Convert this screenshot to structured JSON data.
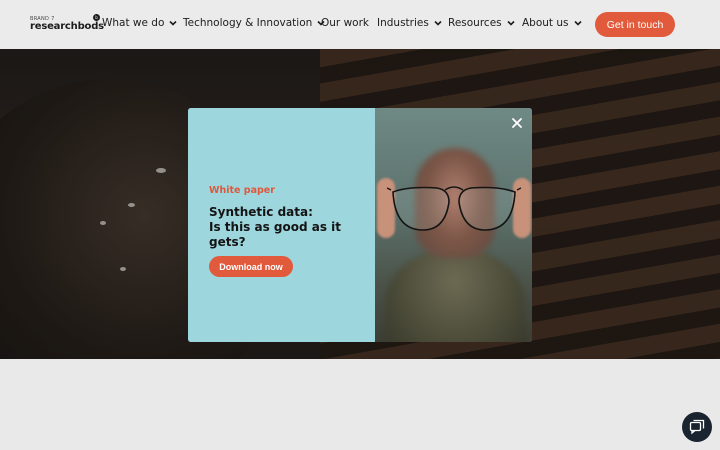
{
  "header": {
    "logo_small": "BRAND 7",
    "logo_main": "researchbods",
    "logo_badge": "b",
    "nav": [
      {
        "label": "What we do",
        "dropdown": true
      },
      {
        "label": "Technology & Innovation",
        "dropdown": true
      },
      {
        "label": "Our work",
        "dropdown": false
      },
      {
        "label": "Industries",
        "dropdown": true
      },
      {
        "label": "Resources",
        "dropdown": true
      },
      {
        "label": "About us",
        "dropdown": true
      }
    ],
    "cta_label": "Get in touch"
  },
  "modal": {
    "eyebrow": "White paper",
    "title_line1": "Synthetic data:",
    "title_line2": "Is this as good as it gets?",
    "button_label": "Download now",
    "close_icon": "close-icon"
  },
  "chat": {
    "icon": "chat-icon"
  },
  "colors": {
    "accent": "#e05a3b",
    "modal_bg": "#9dd6dd",
    "header_bg": "#ebebec",
    "chat_bg": "#1a2430"
  }
}
